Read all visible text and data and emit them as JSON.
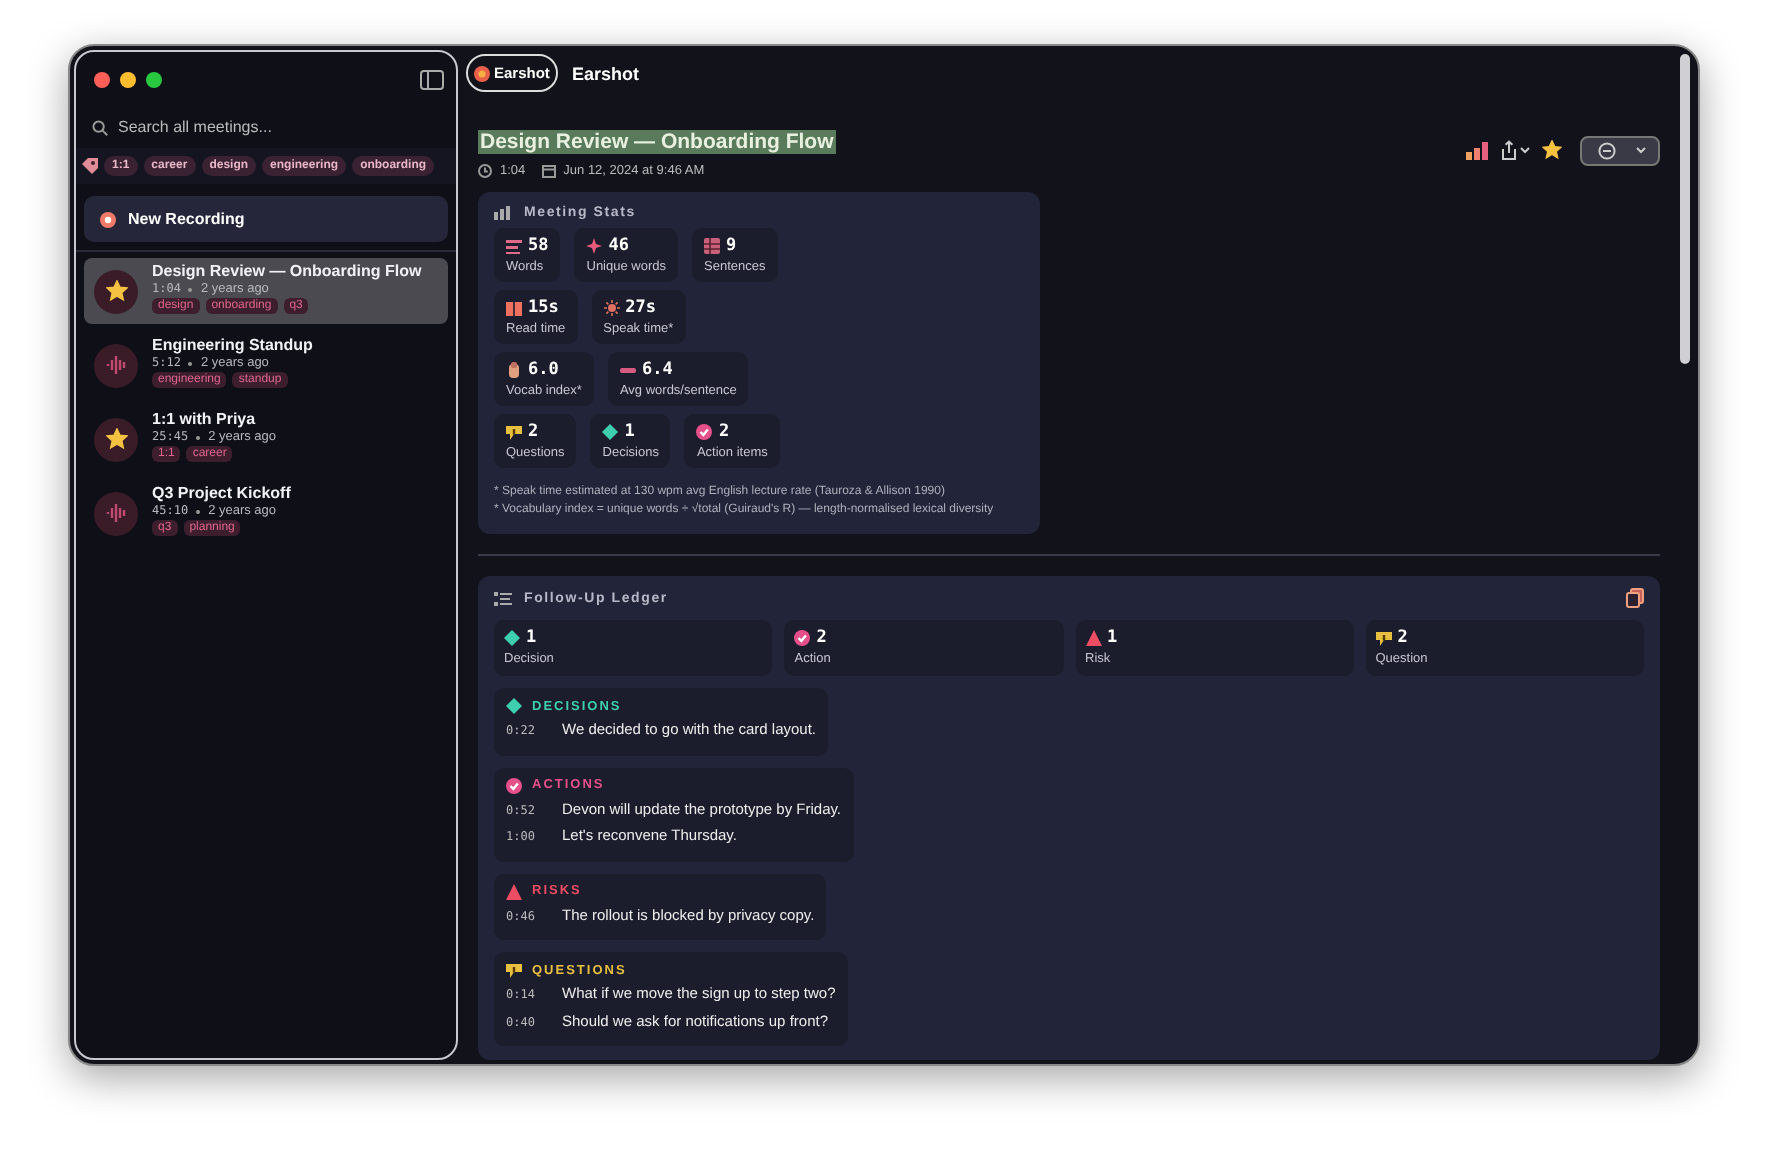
{
  "sidebar": {
    "search": {
      "placeholder": "Search all meetings..."
    },
    "tags": [
      "1:1",
      "career",
      "design",
      "engineering",
      "onboarding"
    ],
    "new_recording": "New Recording",
    "meetings": [
      {
        "title": "Design Review — Onboarding Flow",
        "duration": "1:04",
        "age": "2 years ago",
        "starred": true,
        "selected": true,
        "tags": [
          "design",
          "onboarding",
          "q3"
        ]
      },
      {
        "title": "Engineering Standup",
        "duration": "5:12",
        "age": "2 years ago",
        "starred": false,
        "selected": false,
        "tags": [
          "engineering",
          "standup"
        ]
      },
      {
        "title": "1:1 with Priya",
        "duration": "25:45",
        "age": "2 years ago",
        "starred": true,
        "selected": false,
        "tags": [
          "1:1",
          "career"
        ]
      },
      {
        "title": "Q3 Project Kickoff",
        "duration": "45:10",
        "age": "2 years ago",
        "starred": false,
        "selected": false,
        "tags": [
          "q3",
          "planning"
        ]
      }
    ]
  },
  "header": {
    "tab": "Earshot",
    "title": "Earshot"
  },
  "meeting": {
    "title": "Design Review — Onboarding Flow",
    "highlighted": true,
    "duration": "1:04",
    "date": "Jun 12, 2024 at 9:46 AM",
    "starred": true
  },
  "stats": {
    "title": "Meeting Stats",
    "rows": [
      [
        {
          "kind": "words",
          "value": "58",
          "label": "Words"
        },
        {
          "kind": "unique",
          "value": "46",
          "label": "Unique words"
        },
        {
          "kind": "sentences",
          "value": "9",
          "label": "Sentences"
        }
      ],
      [
        {
          "kind": "read",
          "value": "15s",
          "label": "Read time"
        },
        {
          "kind": "speak",
          "value": "27s",
          "label": "Speak time*"
        }
      ],
      [
        {
          "kind": "vocab",
          "value": "6.0",
          "label": "Vocab index*"
        },
        {
          "kind": "avg",
          "value": "6.4",
          "label": "Avg words/sentence"
        }
      ],
      [
        {
          "kind": "question",
          "value": "2",
          "label": "Questions"
        },
        {
          "kind": "decision",
          "value": "1",
          "label": "Decisions"
        },
        {
          "kind": "action",
          "value": "2",
          "label": "Action items"
        }
      ]
    ],
    "footnotes": [
      "* Speak time estimated at 130 wpm avg English lecture rate (Tauroza & Allison 1990)",
      "* Vocabulary index = unique words ÷ √total (Guiraud's R) — length-normalised lexical diversity"
    ]
  },
  "ledger": {
    "title": "Follow-Up Ledger",
    "summary": [
      {
        "kind": "decision",
        "count": "1",
        "label": "Decision"
      },
      {
        "kind": "action",
        "count": "2",
        "label": "Action"
      },
      {
        "kind": "risk",
        "count": "1",
        "label": "Risk"
      },
      {
        "kind": "question",
        "count": "2",
        "label": "Question"
      }
    ],
    "sections": [
      {
        "kind": "decision",
        "title": "DECISIONS",
        "items": [
          {
            "time": "0:22",
            "text": "We decided to go with the card layout."
          }
        ]
      },
      {
        "kind": "action",
        "title": "ACTIONS",
        "items": [
          {
            "time": "0:52",
            "text": "Devon will update the prototype by Friday."
          },
          {
            "time": "1:00",
            "text": "Let's reconvene Thursday."
          }
        ]
      },
      {
        "kind": "risk",
        "title": "RISKS",
        "items": [
          {
            "time": "0:46",
            "text": "The rollout is blocked by privacy copy."
          }
        ]
      },
      {
        "kind": "question",
        "title": "QUESTIONS",
        "items": [
          {
            "time": "0:14",
            "text": "What if we move the sign up to step two?"
          },
          {
            "time": "0:40",
            "text": "Should we ask for notifications up front?"
          }
        ]
      }
    ]
  }
}
